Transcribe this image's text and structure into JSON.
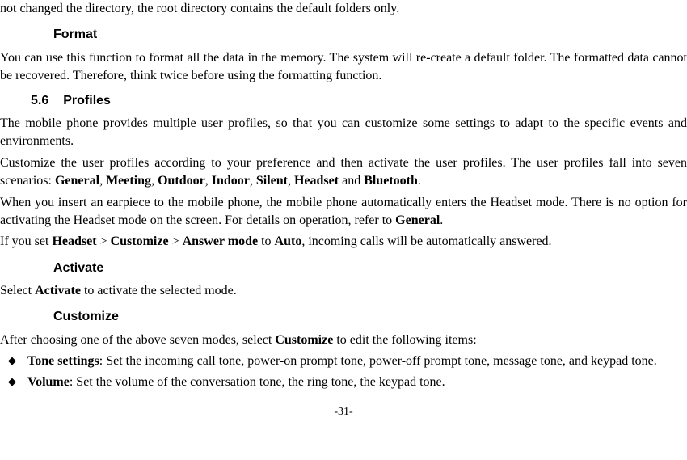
{
  "top_fragment": "not changed the directory, the root directory contains the default folders only.",
  "headings": {
    "format": "Format",
    "section_num": "5.6",
    "section_title": "Profiles",
    "activate": "Activate",
    "customize": "Customize"
  },
  "format_para_a": "You can use this function to format all the data in the memory. The system will re-create a default folder. The formatted data cannot be recovered. Therefore, think twice before using the formatting function.",
  "profiles_para1": "The mobile phone provides multiple user profiles, so that you can customize some settings to adapt to the specific events and environments.",
  "profiles_para2_pre": "Customize the user profiles according to your preference and then activate the user profiles. The user profiles fall into seven scenarios: ",
  "scenarios": {
    "general": "General",
    "meeting": "Meeting",
    "outdoor": "Outdoor",
    "indoor": "Indoor",
    "silent": "Silent",
    "headset": "Headset",
    "bluetooth": "Bluetooth"
  },
  "profiles_para3_a": "When you insert an earpiece to the mobile phone, the mobile phone automatically enters the Headset mode. There is no option for activating the Headset mode on the screen. For details on operation, refer to ",
  "profiles_para3_b": ".",
  "profiles_para4_a": "If you set ",
  "profiles_para4_b": " > ",
  "profiles_para4_c": " > ",
  "profiles_para4_d": " to ",
  "profiles_para4_e": ", incoming calls will be automatically answered.",
  "answer_mode": "Answer mode",
  "customize_word": "Customize",
  "auto_word": "Auto",
  "activate_para_a": "Select ",
  "activate_word": "Activate",
  "activate_para_b": " to activate the selected mode.",
  "customize_para_a": "After choosing one of the above seven modes, select ",
  "customize_para_b": " to edit the following items:",
  "bullets": {
    "tone_label": "Tone settings",
    "tone_text": ": Set the incoming call tone, power-on prompt tone, power-off prompt tone, message tone, and keypad tone.",
    "volume_label": "Volume",
    "volume_text": ": Set the volume of the conversation tone, the ring tone, the keypad tone."
  },
  "page_number": "-31-",
  "sep": {
    "comma": ", ",
    "and": " and ",
    "period": "."
  }
}
